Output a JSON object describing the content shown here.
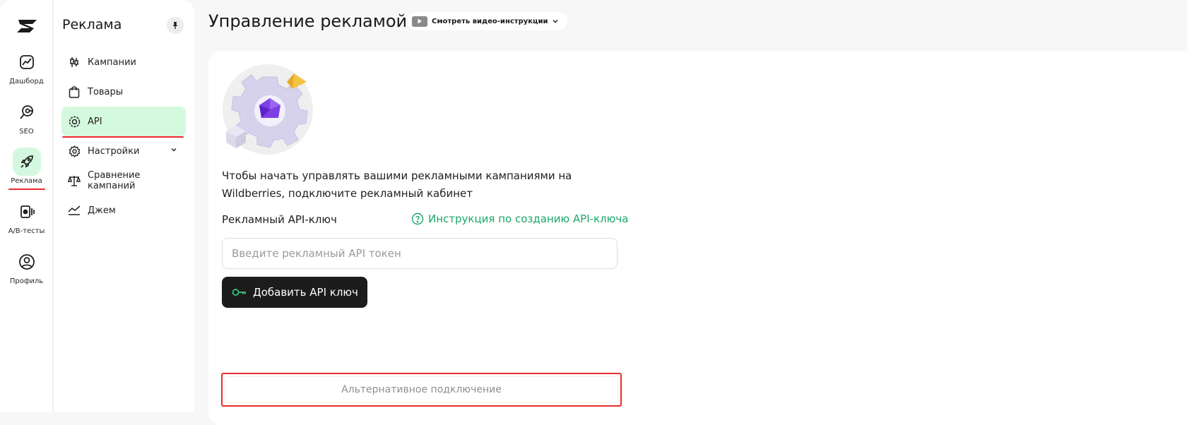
{
  "rail": {
    "items": [
      {
        "label": "Дашборд",
        "icon": "dashboard-chart-icon",
        "active": false
      },
      {
        "label": "SEO",
        "icon": "seo-search-icon",
        "active": false
      },
      {
        "label": "Реклама",
        "icon": "rocket-icon",
        "active": true
      },
      {
        "label": "A/B-тесты",
        "icon": "ab-test-icon",
        "active": false
      },
      {
        "label": "Профиль",
        "icon": "profile-icon",
        "active": false
      }
    ]
  },
  "sidebar": {
    "title": "Реклама",
    "items": [
      {
        "label": "Кампании",
        "icon": "candlestick-icon",
        "active": false
      },
      {
        "label": "Товары",
        "icon": "shopping-bag-icon",
        "active": false
      },
      {
        "label": "API",
        "icon": "api-icon",
        "active": true
      },
      {
        "label": "Настройки",
        "icon": "gear-icon",
        "active": false,
        "expandable": true
      },
      {
        "label": "Сравнение кампаний",
        "icon": "scales-icon",
        "active": false
      },
      {
        "label": "Джем",
        "icon": "trend-line-icon",
        "active": false
      }
    ]
  },
  "header": {
    "title": "Управление рекламой",
    "video_button": "Смотреть видео-инструкции"
  },
  "main": {
    "description": "Чтобы начать управлять вашими рекламными кампаниями на Wildberries, подключите рекламный кабинет",
    "field_label": "Рекламный API-ключ",
    "instruction_link": "Инструкция по созданию API-ключа",
    "token_input": {
      "value": "",
      "placeholder": "Введите рекламный API токен"
    },
    "add_button": "Добавить API ключ",
    "alternative_button": "Альтернативное подключение"
  },
  "colors": {
    "accent_green": "#1aa86a",
    "active_bg": "#d4f9df",
    "highlight_red": "#ee2b2b",
    "dark_button": "#1c1c1c"
  }
}
